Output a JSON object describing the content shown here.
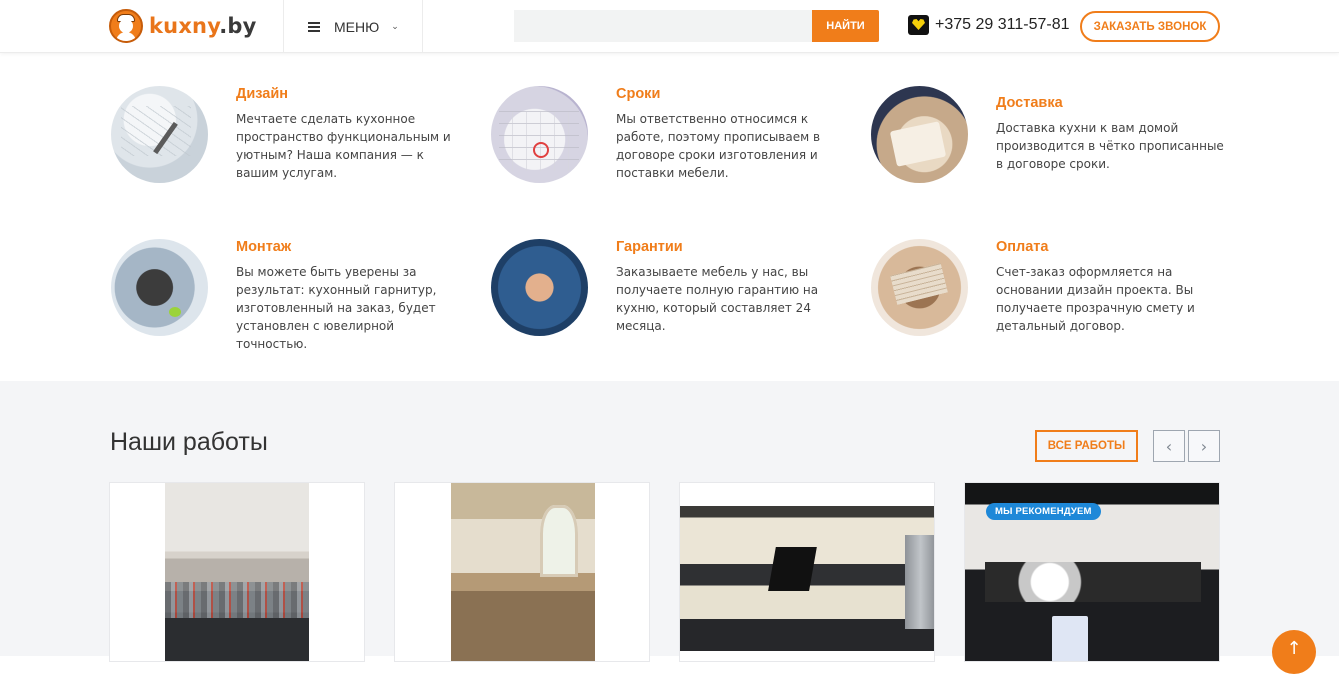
{
  "header": {
    "logo_name": "kuxny",
    "logo_domain": ".by",
    "menu_label": "МЕНЮ",
    "search_placeholder": "",
    "search_value": "",
    "search_button": "НАЙТИ",
    "phone": "+375 29 311-57-81",
    "callback_button": "ЗАКАЗАТЬ ЗВОНОК"
  },
  "features": [
    {
      "icon": "design-drawing-image",
      "title": "Дизайн",
      "text": "Мечтаете сделать кухонное пространство функциональным и уютным? Наша компания — к вашим услугам."
    },
    {
      "icon": "calendar-image",
      "title": "Сроки",
      "text": "Мы ответственно относимся к работе, поэтому прописываем в договоре сроки изготовления и поставки мебели."
    },
    {
      "icon": "delivery-signing-image",
      "title": "Доставка",
      "text": "Доставка кухни к вам домой производится в чётко прописанные в договоре сроки."
    },
    {
      "icon": "drill-image",
      "title": "Монтаж",
      "text": "Вы можете быть уверены за результат: кухонный гарнитур, изготовленный на заказ, будет установлен с ювелирной точностью."
    },
    {
      "icon": "thumbs-up-image",
      "title": "Гарантии",
      "text": "Заказываете мебель у нас, вы получаете полную гарантию на кухню, который составляет 24 месяца."
    },
    {
      "icon": "wallet-money-image",
      "title": "Оплата",
      "text": "Счет-заказ оформляется на основании дизайн проекта. Вы получаете прозрачную смету и детальный договор."
    }
  ],
  "works": {
    "title": "Наши работы",
    "all_button": "ВСЕ РАБОТЫ",
    "prev_icon": "‹",
    "next_icon": "›",
    "cards": [
      {
        "badge": ""
      },
      {
        "badge": ""
      },
      {
        "badge": ""
      },
      {
        "badge": "МЫ РЕКОМЕНДУЕМ"
      }
    ]
  },
  "scroll_top_icon": "↑",
  "colors": {
    "accent": "#f07d1a",
    "badge": "#1e88d8",
    "section_bg": "#f4f5f7"
  }
}
